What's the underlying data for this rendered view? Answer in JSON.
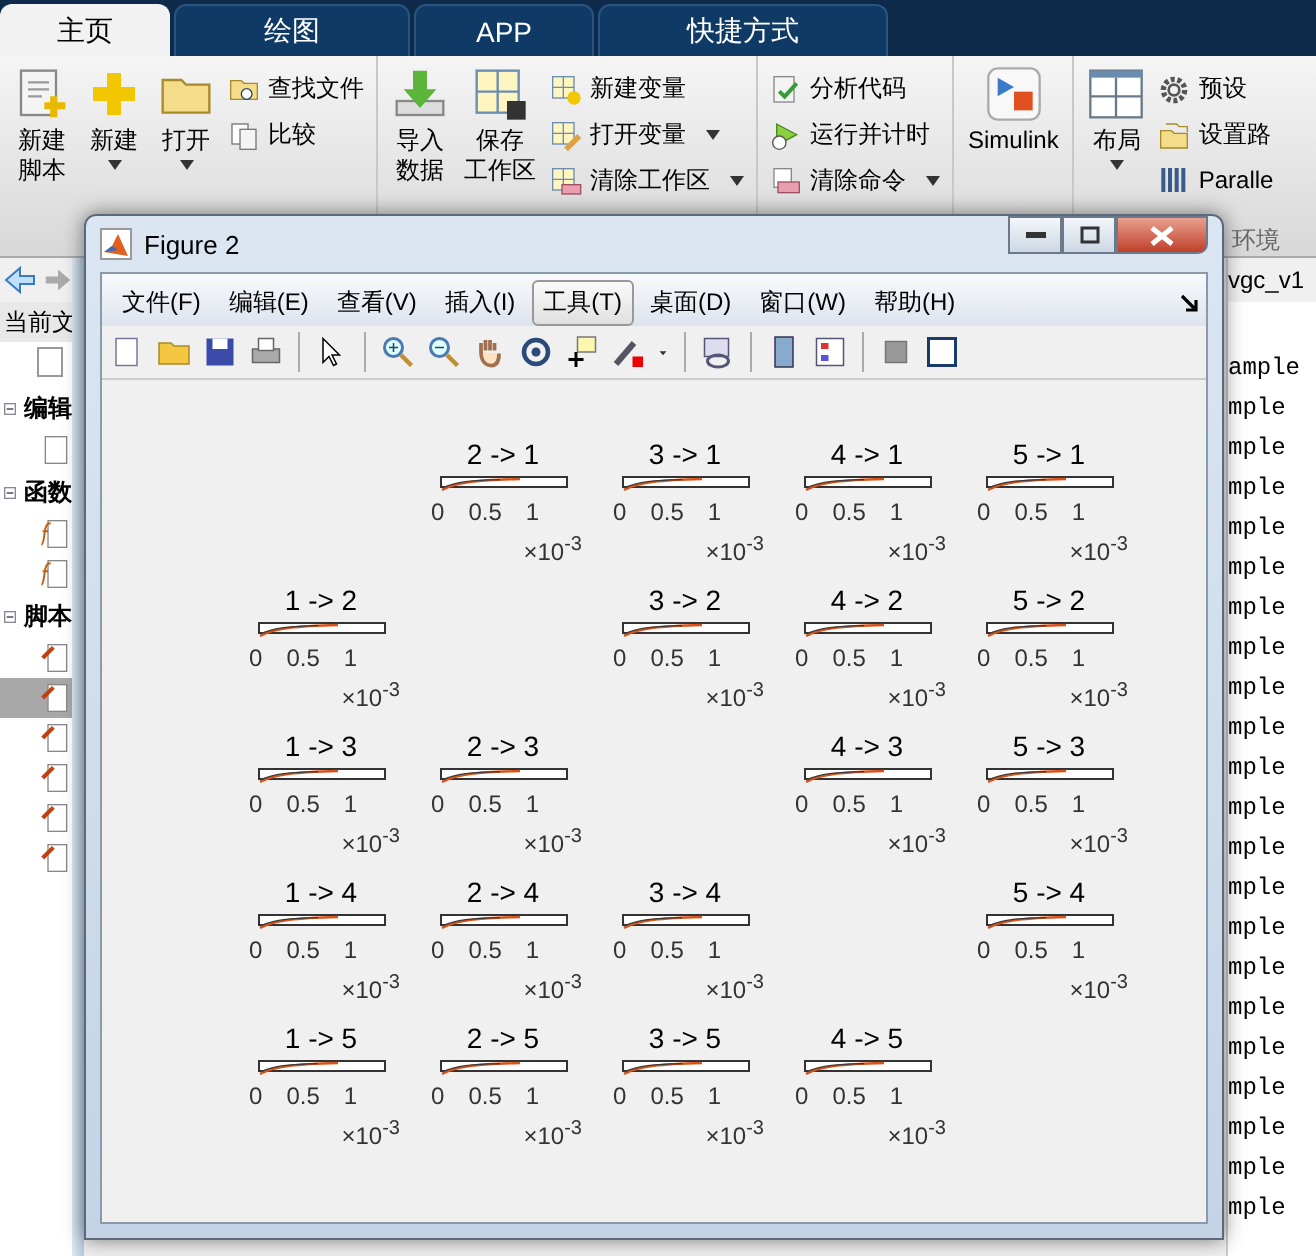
{
  "tabs": [
    {
      "label": "主页",
      "selected": true
    },
    {
      "label": "绘图",
      "selected": false
    },
    {
      "label": "APP",
      "selected": false
    },
    {
      "label": "快捷方式",
      "selected": false
    }
  ],
  "ribbon": {
    "groups": [
      {
        "items": [
          {
            "kind": "large",
            "lines": [
              "新建",
              "脚本"
            ],
            "dropdown": false
          },
          {
            "kind": "large",
            "lines": [
              "新建"
            ],
            "dropdown": true
          },
          {
            "kind": "large",
            "lines": [
              "打开"
            ],
            "dropdown": true
          },
          {
            "kind": "small",
            "label": "查找文件",
            "dropdown": false
          },
          {
            "kind": "small",
            "label": "比较",
            "dropdown": false
          }
        ]
      },
      {
        "items": [
          {
            "kind": "large",
            "lines": [
              "导入",
              "数据"
            ],
            "dropdown": false
          },
          {
            "kind": "large",
            "lines": [
              "保存",
              "工作区"
            ],
            "dropdown": false
          },
          {
            "kind": "small",
            "label": "新建变量",
            "dropdown": false
          },
          {
            "kind": "small",
            "label": "打开变量",
            "dropdown": true
          },
          {
            "kind": "small",
            "label": "清除工作区",
            "dropdown": true
          }
        ]
      },
      {
        "items": [
          {
            "kind": "small",
            "label": "分析代码",
            "dropdown": false
          },
          {
            "kind": "small",
            "label": "运行并计时",
            "dropdown": false
          },
          {
            "kind": "small",
            "label": "清除命令",
            "dropdown": true
          }
        ]
      },
      {
        "items": [
          {
            "kind": "large",
            "lines": [
              "Simulink"
            ],
            "dropdown": false
          }
        ]
      },
      {
        "label": "环境",
        "items": [
          {
            "kind": "large",
            "lines": [
              "布局"
            ],
            "dropdown": true
          },
          {
            "kind": "small",
            "label": "预设",
            "dropdown": false
          },
          {
            "kind": "small",
            "label": "设置路",
            "dropdown": false
          },
          {
            "kind": "small",
            "label": "Paralle",
            "dropdown": false
          }
        ]
      }
    ]
  },
  "files_panel": {
    "title": "当前文",
    "tree": [
      {
        "label": "编辑",
        "expanded": true,
        "children": [
          {
            "kind": "blank",
            "selected": false
          }
        ]
      },
      {
        "label": "函数",
        "expanded": true,
        "children": [
          {
            "kind": "function",
            "selected": false
          },
          {
            "kind": "function",
            "selected": false
          }
        ]
      },
      {
        "label": "脚本",
        "expanded": true,
        "children": [
          {
            "kind": "script",
            "selected": false
          },
          {
            "kind": "script",
            "selected": true
          },
          {
            "kind": "script",
            "selected": false
          },
          {
            "kind": "script",
            "selected": false
          },
          {
            "kind": "script",
            "selected": false
          },
          {
            "kind": "script",
            "selected": false
          }
        ]
      }
    ]
  },
  "editor": {
    "tab": "vgc_v1",
    "lines": [
      "ample",
      "mple",
      "mple",
      "mple",
      "mple",
      "mple",
      "mple",
      "mple",
      "mple",
      "mple",
      "mple",
      "mple",
      "mple",
      "mple",
      "mple",
      "mple",
      "mple",
      "mple",
      "mple",
      "mple",
      "mple",
      "mple"
    ]
  },
  "figure": {
    "title": "Figure 2",
    "menu": [
      {
        "label": "文件(F)",
        "selected": false
      },
      {
        "label": "编辑(E)",
        "selected": false
      },
      {
        "label": "查看(V)",
        "selected": false
      },
      {
        "label": "插入(I)",
        "selected": false
      },
      {
        "label": "工具(T)",
        "selected": true
      },
      {
        "label": "桌面(D)",
        "selected": false
      },
      {
        "label": "窗口(W)",
        "selected": false
      },
      {
        "label": "帮助(H)",
        "selected": false
      }
    ],
    "subplot_rows": [
      {
        "cells": [
          {
            "kind": "empty"
          },
          {
            "kind": "plot",
            "title": "2 -> 1",
            "ticks": [
              "0",
              "0.5",
              "1"
            ],
            "exponent": "×10$^{-3}$"
          },
          {
            "kind": "plot",
            "title": "3 -> 1",
            "ticks": [
              "0",
              "0.5",
              "1"
            ],
            "exponent": "×10$^{-3}$"
          },
          {
            "kind": "plot",
            "title": "4 -> 1",
            "ticks": [
              "0",
              "0.5",
              "1"
            ],
            "exponent": "×10$^{-3}$"
          },
          {
            "kind": "plot",
            "title": "5 -> 1",
            "ticks": [
              "0",
              "0.5",
              "1"
            ],
            "exponent": "×10$^{-3}$"
          }
        ]
      },
      {
        "cells": [
          {
            "kind": "plot",
            "title": "1 -> 2",
            "ticks": [
              "0",
              "0.5",
              "1"
            ],
            "exponent": "×10$^{-3}$"
          },
          {
            "kind": "empty"
          },
          {
            "kind": "plot",
            "title": "3 -> 2",
            "ticks": [
              "0",
              "0.5",
              "1"
            ],
            "exponent": "×10$^{-3}$"
          },
          {
            "kind": "plot",
            "title": "4 -> 2",
            "ticks": [
              "0",
              "0.5",
              "1"
            ],
            "exponent": "×10$^{-3}$"
          },
          {
            "kind": "plot",
            "title": "5 -> 2",
            "ticks": [
              "0",
              "0.5",
              "1"
            ],
            "exponent": "×10$^{-3}$"
          }
        ]
      },
      {
        "cells": [
          {
            "kind": "plot",
            "title": "1 -> 3",
            "ticks": [
              "0",
              "0.5",
              "1"
            ],
            "exponent": "×10$^{-3}$"
          },
          {
            "kind": "plot",
            "title": "2 -> 3",
            "ticks": [
              "0",
              "0.5",
              "1"
            ],
            "exponent": "×10$^{-3}$"
          },
          {
            "kind": "empty"
          },
          {
            "kind": "plot",
            "title": "4 -> 3",
            "ticks": [
              "0",
              "0.5",
              "1"
            ],
            "exponent": "×10$^{-3}$"
          },
          {
            "kind": "plot",
            "title": "5 -> 3",
            "ticks": [
              "0",
              "0.5",
              "1"
            ],
            "exponent": "×10$^{-3}$"
          }
        ]
      },
      {
        "cells": [
          {
            "kind": "plot",
            "title": "1 -> 4",
            "ticks": [
              "0",
              "0.5",
              "1"
            ],
            "exponent": "×10$^{-3}$"
          },
          {
            "kind": "plot",
            "title": "2 -> 4",
            "ticks": [
              "0",
              "0.5",
              "1"
            ],
            "exponent": "×10$^{-3}$"
          },
          {
            "kind": "plot",
            "title": "3 -> 4",
            "ticks": [
              "0",
              "0.5",
              "1"
            ],
            "exponent": "×10$^{-3}$"
          },
          {
            "kind": "empty"
          },
          {
            "kind": "plot",
            "title": "5 -> 4",
            "ticks": [
              "0",
              "0.5",
              "1"
            ],
            "exponent": "×10$^{-3}$"
          }
        ]
      },
      {
        "cells": [
          {
            "kind": "plot",
            "title": "1 -> 5",
            "ticks": [
              "0",
              "0.5",
              "1"
            ],
            "exponent": "×10$^{-3}$"
          },
          {
            "kind": "plot",
            "title": "2 -> 5",
            "ticks": [
              "0",
              "0.5",
              "1"
            ],
            "exponent": "×10$^{-3}$"
          },
          {
            "kind": "plot",
            "title": "3 -> 5",
            "ticks": [
              "0",
              "0.5",
              "1"
            ],
            "exponent": "×10$^{-3}$"
          },
          {
            "kind": "plot",
            "title": "4 -> 5",
            "ticks": [
              "0",
              "0.5",
              "1"
            ],
            "exponent": "×10$^{-3}$"
          },
          {
            "kind": "empty"
          }
        ]
      }
    ]
  }
}
